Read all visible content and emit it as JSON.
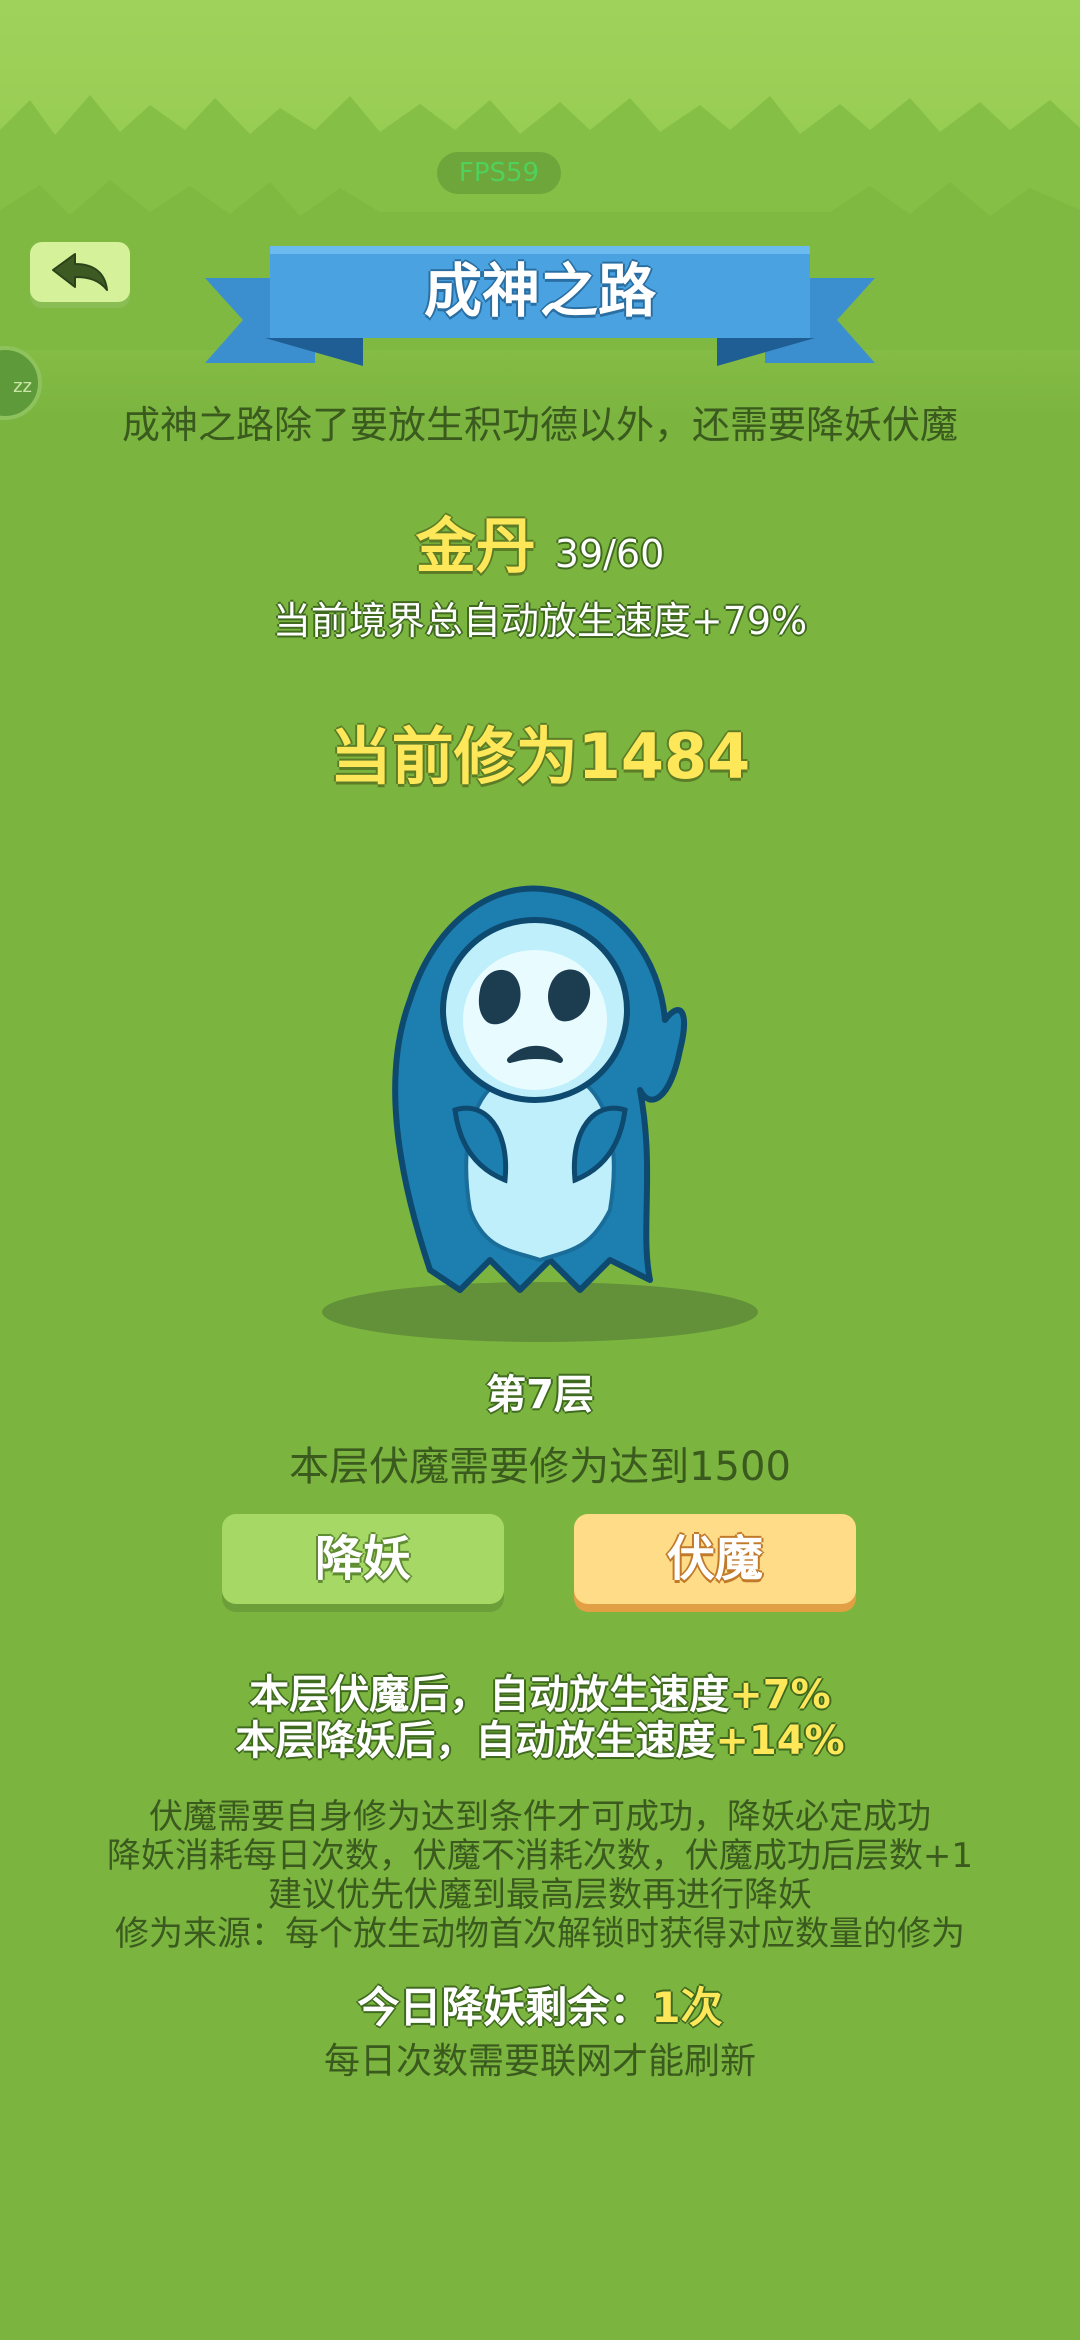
{
  "hud": {
    "fps": "FPS59"
  },
  "header": {
    "title": "成神之路"
  },
  "intro": "成神之路除了要放生积功德以外，还需要降妖伏魔",
  "realm": {
    "name": "金丹",
    "progress": "39/60",
    "bonus_text": "当前境界总自动放生速度+79%"
  },
  "cultivation": {
    "text": "当前修为1484"
  },
  "floor": {
    "label": "第7层",
    "requirement": "本层伏魔需要修为达到1500"
  },
  "actions": {
    "subdue_label": "降妖",
    "conquer_label": "伏魔"
  },
  "bonuses": {
    "conquer_prefix": "本层伏魔后，自动放生速度",
    "conquer_value": "+7%",
    "subdue_prefix": "本层降妖后，自动放生速度",
    "subdue_value": "+14%"
  },
  "rules": [
    "伏魔需要自身修为达到条件才可成功，降妖必定成功",
    "降妖消耗每日次数，伏魔不消耗次数，伏魔成功后层数+1",
    "建议优先伏魔到最高层数再进行降妖",
    "修为来源：每个放生动物首次解锁时获得对应数量的修为"
  ],
  "daily": {
    "prefix": "今日降妖剩余：",
    "count": "1次",
    "note": "每日次数需要联网才能刷新"
  },
  "colors": {
    "background": "#7bb43f",
    "banner": "#4a9fdc",
    "highlight_yellow": "#ffe75a",
    "subdue_button": "#a6d866",
    "conquer_button": "#ffdc87"
  },
  "icons": {
    "back": "back-arrow-icon",
    "side_badge": "zz-badge-icon",
    "monster": "ghost-monster-icon"
  }
}
